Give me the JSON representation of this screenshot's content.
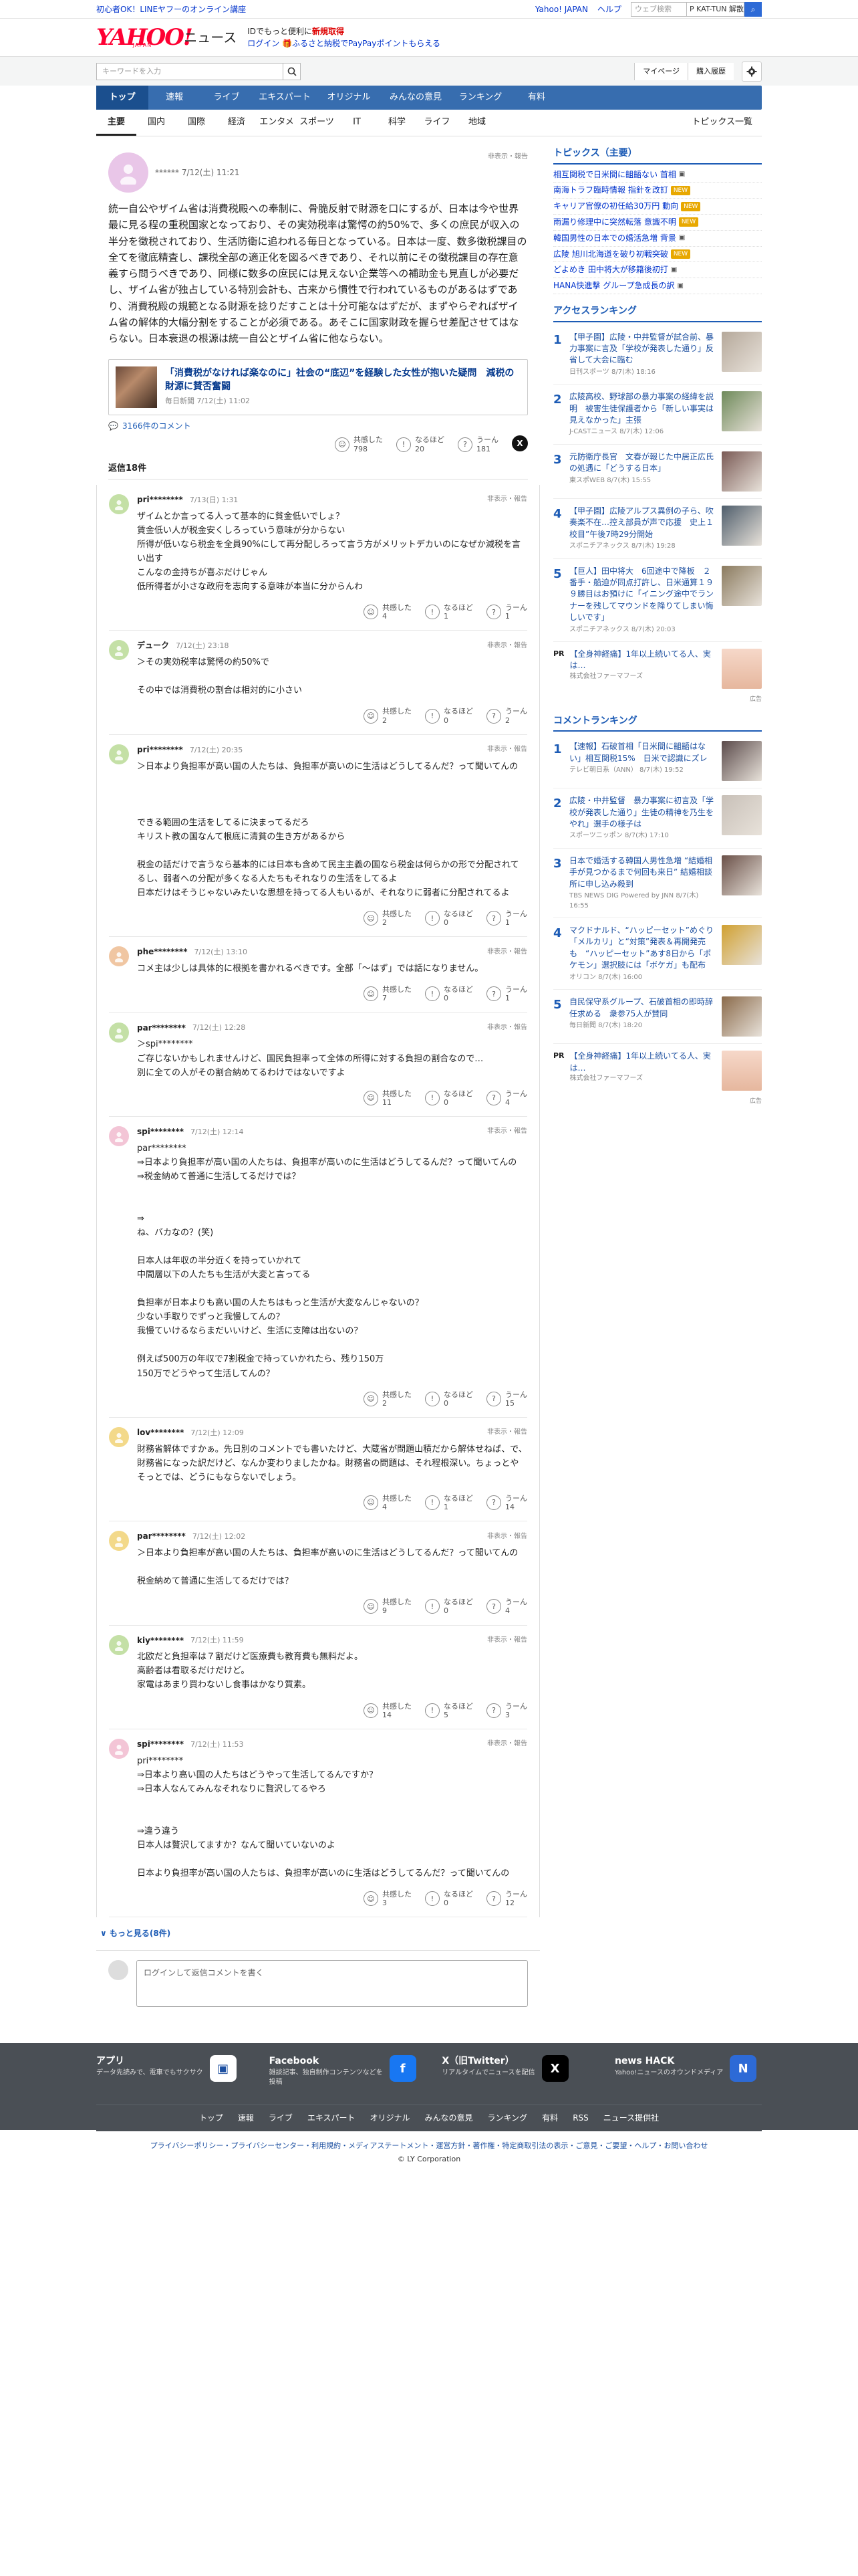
{
  "promo": {
    "left": "初心者OK！LINEヤフーのオンライン講座",
    "links": [
      "Yahoo! JAPAN",
      "ヘルプ"
    ],
    "search_placeholder": "ウェブ検索",
    "search_keyword": "P KAT-TUN 解散"
  },
  "brand": {
    "logo": "YAHOO!",
    "logo_sub": "JAPAN",
    "service": "ニュース",
    "line1_prefix": "IDでもっと便利に",
    "line1_link": "新規取得",
    "line2_login": "ログイン",
    "line2_text": "ふるさと納税でPayPayポイントもらえる"
  },
  "search": {
    "placeholder": "キーワードを入力",
    "mypage": "マイページ",
    "history": "購入履歴"
  },
  "gnav": [
    "トップ",
    "速報",
    "ライブ",
    "エキスパート",
    "オリジナル",
    "みんなの意見",
    "ランキング",
    "有料"
  ],
  "snav": [
    "主要",
    "国内",
    "国際",
    "経済",
    "エンタメ",
    "スポーツ",
    "IT",
    "科学",
    "ライフ",
    "地域"
  ],
  "snav_list": "トピックス一覧",
  "top_comment": {
    "user": "******",
    "date": "7/12(土) 11:21",
    "report": "非表示・報告",
    "body": "統一自公やザイム省は消費税殿への奉制に、骨脆反射で財源を口にするが、日本は今や世界最に見る程の重税国家となっており、その実効税率は驚愕の約50%で、多くの庶民が収入の半分を徴税されており、生活防衛に追われる毎日となっている。日本は一度、数多徴税課目の全てを徹底精査し、課税全部の適正化を図るべきであり、それ以前にその徴税課目の存在意義すら問うべきであり、同様に数多の庶民には見えない企業等への補助金も見直しが必要だし、ザイム省が独占している特別会計も、古来から慣性で行われているものがあるはずであり、消費税殿の規範となる財源を捻りだすことは十分可能なはずだが、まずやらぞればザイム省の解体的大幅分割をすることが必須である。あそこに国家財政を握らせ差配させてはならない。日本衰退の根源は統一自公とザイム省に他ならない。",
    "article_title": "「消費税がなければ楽なのに」社会の“底辺”を経験した女性が抱いた疑問　減税の財源に賛否奮闘",
    "article_source": "毎日新聞 7/12(土) 11:02",
    "comment_count": "3166件のコメント",
    "reactions": {
      "agree_label": "共感した",
      "agree": "798",
      "hmm_label": "なるほど",
      "hmm": "20",
      "uun_label": "うーん",
      "uun": "181"
    }
  },
  "reply_header": "返信18件",
  "replies": [
    {
      "user": "pri********",
      "date": "7/13(日) 1:31",
      "color": "#c4e0a6",
      "text": "ザイムとか言ってる人って基本的に貧金低いでしょ？\n賃金低い人が税金安くしろっていう意味が分からない\n所得が低いなら税金を全員90%にして再分配しろって言う方がメリットデカいのになぜか減税を言い出す\nこんなの金持ちが喜ぶだけじゃん\n低所得者が小さな政府を志向する意味が本当に分からんわ",
      "a": "4",
      "h": "1",
      "u": "1"
    },
    {
      "user": "デューク",
      "date": "7/12(土) 23:18",
      "color": "#c4e0a6",
      "text": "＞その実効税率は驚愕の約50%で\n\nその中では消費税の割合は相対的に小さい",
      "a": "2",
      "h": "0",
      "u": "2"
    },
    {
      "user": "pri********",
      "date": "7/12(土) 20:35",
      "color": "#c4e0a6",
      "text": "＞日本より負担率が高い国の人たちは、負担率が高いのに生活はどうしてるんだ？って聞いてんの\n\n\n\nできる範囲の生活をしてるに決まってるだろ\nキリスト教の国なんて根底に清貧の生き方があるから\n\n税金の話だけで言うなら基本的には日本も含めて民主主義の国なら税金は何らかの形で分配されてるし、弱者への分配が多くなる人たちもそれなりの生活をしてるよ\n日本だけはそうじゃないみたいな思想を持ってる人もいるが、それなりに弱者に分配されてるよ",
      "a": "2",
      "h": "0",
      "u": "1"
    },
    {
      "user": "phe********",
      "date": "7/12(土) 13:10",
      "color": "#f0c6a2",
      "text": "コメ主は少しは具体的に根拠を書かれるべきです。全部「〜はず」では話になりません。",
      "a": "7",
      "h": "0",
      "u": "1"
    },
    {
      "user": "par********",
      "date": "7/12(土) 12:28",
      "color": "#c4e0a6",
      "text": "＞spi********\nご存じないかもしれませんけど、国民負担率って全体の所得に対する負担の割合なので…\n別に全ての人がその割合納めてるわけではないですよ",
      "a": "11",
      "h": "0",
      "u": "4"
    },
    {
      "user": "spi********",
      "date": "7/12(土) 12:14",
      "color": "#f3c5d6",
      "text": "par********\n⇒日本より負担率が高い国の人たちは、負担率が高いのに生活はどうしてるんだ？って聞いてんの\n⇒税金納めて普通に生活してるだけでは？\n\n\n⇒\nね、バカなの？(笑)\n\n日本人は年収の半分近くを持っていかれて\n中間層以下の人たちも生活が大変と言ってる\n\n負担率が日本よりも高い国の人たちはもっと生活が大変なんじゃないの？\n少ない手取りでずっと我慢してんの？\n我慢ていけるならまだいいけど、生活に支障は出ないの？\n\n例えば500万の年収で7割税金で持っていかれたら、残り150万\n150万でどうやって生活してんの？",
      "a": "2",
      "h": "0",
      "u": "15"
    },
    {
      "user": "lov********",
      "date": "7/12(土) 12:09",
      "color": "#f3d98a",
      "text": "財務省解体ですかぁ。先日別のコメントでも書いたけど、大蔵省が問題山積だから解体せねば、で、財務省になった訳だけど、なんか変わりましたかね。財務省の問題は、それ程根深い。ちょっとやそっとでは、どうにもならないでしょう。",
      "a": "4",
      "h": "1",
      "u": "14"
    },
    {
      "user": "par********",
      "date": "7/12(土) 12:02",
      "color": "#f3d98a",
      "text": "＞日本より負担率が高い国の人たちは、負担率が高いのに生活はどうしてるんだ？って聞いてんの\n\n税金納めて普通に生活してるだけでは？",
      "a": "9",
      "h": "0",
      "u": "4"
    },
    {
      "user": "kiy********",
      "date": "7/12(土) 11:59",
      "color": "#c4e0a6",
      "text": "北欧だと負担率は７割だけど医療費も教育費も無料だよ。\n高齢者は看取るだけだけど。\n家電はあまり買わないし食事はかなり質素。",
      "a": "14",
      "h": "5",
      "u": "3"
    },
    {
      "user": "spi********",
      "date": "7/12(土) 11:53",
      "color": "#f3c5d6",
      "text": "pri********\n⇒日本より高い国の人たちはどうやって生活してるんですか？\n⇒日本人なんてみんなそれなりに贅沢してるやろ\n\n\n⇒違う違う\n日本人は贅沢してますか？なんて聞いていないのよ\n\n日本より負担率が高い国の人たちは、負担率が高いのに生活はどうしてるんだ？って聞いてんの",
      "a": "3",
      "h": "0",
      "u": "12"
    }
  ],
  "more": "もっと見る(8件)",
  "reply_placeholder": "ログインして返信コメントを書く",
  "topics": {
    "title": "トピックス（主要）",
    "items": [
      {
        "text": "相互関税で日米間に齟齬ない 首相",
        "badge": "",
        "badge_color": ""
      },
      {
        "text": "南海トラフ臨時情報 指針を改訂",
        "badge": "NEW",
        "badge_color": "#e8a800"
      },
      {
        "text": "キャリア官僚の初任給30万円 動向",
        "badge": "NEW",
        "badge_color": "#e8a800"
      },
      {
        "text": "雨漏り修理中に突然転落 意識不明",
        "badge": "NEW",
        "badge_color": "#e8a800"
      },
      {
        "text": "韓国男性の日本での婚活急増 背景",
        "badge": "",
        "badge_color": ""
      },
      {
        "text": "広陵 旭川北海道を破り初戦突破",
        "badge": "NEW",
        "badge_color": "#e8a800"
      },
      {
        "text": "どよめき 田中将大が移籍後初打",
        "badge": "",
        "badge_color": ""
      },
      {
        "text": "HANA快進撃 グループ急成長の訳",
        "badge": "",
        "badge_color": ""
      }
    ]
  },
  "access_ranking": {
    "title": "アクセスランキング",
    "items": [
      {
        "no": "1",
        "title": "【甲子園】広陵・中井監督が試合前、暴力事案に言及「学校が発表した通り」反省して大会に臨む",
        "src": "日刊スポーツ 8/7(木) 18:16",
        "color": "#b5a89a"
      },
      {
        "no": "2",
        "title": "広陵高校、野球部の暴力事案の経緯を説明　被害生徒保護者から「新しい事実は見えなかった」主張",
        "src": "J-CASTニュース 8/7(木) 12:06",
        "color": "#6f8a5a"
      },
      {
        "no": "3",
        "title": "元防衛庁長官　文春が報じた中居正広氏の処遇に「どうする日本」",
        "src": "東スポWEB 8/7(木) 15:55",
        "color": "#7a5a55"
      },
      {
        "no": "4",
        "title": "【甲子園】広陵アルプス異例の子ら、吹奏楽不在…控え部員が声で応援　史上１校目”午後7時29分開始",
        "src": "スポニチアネックス 8/7(木) 19:28",
        "color": "#4e5d6b"
      },
      {
        "no": "5",
        "title": "【巨人】田中将大　6回途中で降板　２番手・船迫が同点打許し、日米通算１９９勝目はお預けに「イニング途中でランナーを残してマウンドを降りてしまい悔しいです」",
        "src": "スポニチアネックス 8/7(木) 20:03",
        "color": "#8a7a5e"
      }
    ],
    "pr_label": "PR",
    "pr_title": "【全身神経痛】1年以上続いてる人、実は…",
    "pr_src": "株式会社ファーマフーズ",
    "ad": "広告"
  },
  "comment_ranking": {
    "title": "コメントランキング",
    "items": [
      {
        "no": "1",
        "title": "【速報】石破首相「日米間に齟齬はない」相互関税15%　日米で認識にズレ",
        "src": "テレビ朝日系（ANN） 8/7(木) 19:52",
        "color": "#5a4a4a"
      },
      {
        "no": "2",
        "title": "広陵・中井監督　暴力事案に初言及「学校が発表した通り」生徒の精神を乃生をやれ」選手の様子は",
        "src": "スポーツニッポン 8/7(木) 17:10",
        "color": "#c8c0b8"
      },
      {
        "no": "3",
        "title": "日本で婚活する韓国人男性急増 “結婚相手が見つかるまで何回も来日” 結婚相談所に申し込み殺到",
        "src": "TBS NEWS DIG Powered by JNN 8/7(木) 16:55",
        "color": "#6a5048"
      },
      {
        "no": "4",
        "title": "マクドナルド、“ハッピーセット”めぐり「メルカリ」と“対策”発表＆再開発売も　“ハッピーセット”あす8日から「ポケモン」選択肢には「ボケガ」も配布",
        "src": "オリコン 8/7(木) 16:00",
        "color": "#d0a030"
      },
      {
        "no": "5",
        "title": "自民保守系グループ、石破首相の即時辞任求める　衆参75人が賛同",
        "src": "毎日新聞 8/7(木) 18:20",
        "color": "#8a6a4a"
      }
    ],
    "pr_label": "PR",
    "pr_title": "【全身神経痛】1年以上続いてる人、実は…",
    "pr_src": "株式会社ファーマフーズ",
    "ad": "広告"
  },
  "footer": {
    "cards": [
      {
        "title": "アプリ",
        "desc": "データ先読みで、電車でもサクサク",
        "icon": "▣",
        "icon_bg": "#ffffff",
        "icon_fg": "#1c4fa0"
      },
      {
        "title": "Facebook",
        "desc": "雑談記事、独自制作コンテンツなどを投稿",
        "icon": "f",
        "icon_bg": "#1877f2",
        "icon_fg": "#ffffff"
      },
      {
        "title": "X（旧Twitter）",
        "desc": "リアルタイムでニュースを配信",
        "icon": "X",
        "icon_bg": "#000000",
        "icon_fg": "#ffffff"
      },
      {
        "title": "news HACK",
        "desc": "Yahoo!ニュースのオウンドメディア",
        "icon": "N",
        "icon_bg": "#2d6ad6",
        "icon_fg": "#ffffff"
      }
    ],
    "nav": [
      "トップ",
      "速報",
      "ライブ",
      "エキスパート",
      "オリジナル",
      "みんなの意見",
      "ランキング",
      "有料",
      "RSS",
      "ニュース提供社"
    ],
    "links": "プライバシーポリシー・プライバシーセンター・利用規約・メディアステートメント・運営方針・著作権・特定商取引法の表示・ご意見・ご要望・ヘルプ・お問い合わせ",
    "copyright": "© LY Corporation"
  }
}
